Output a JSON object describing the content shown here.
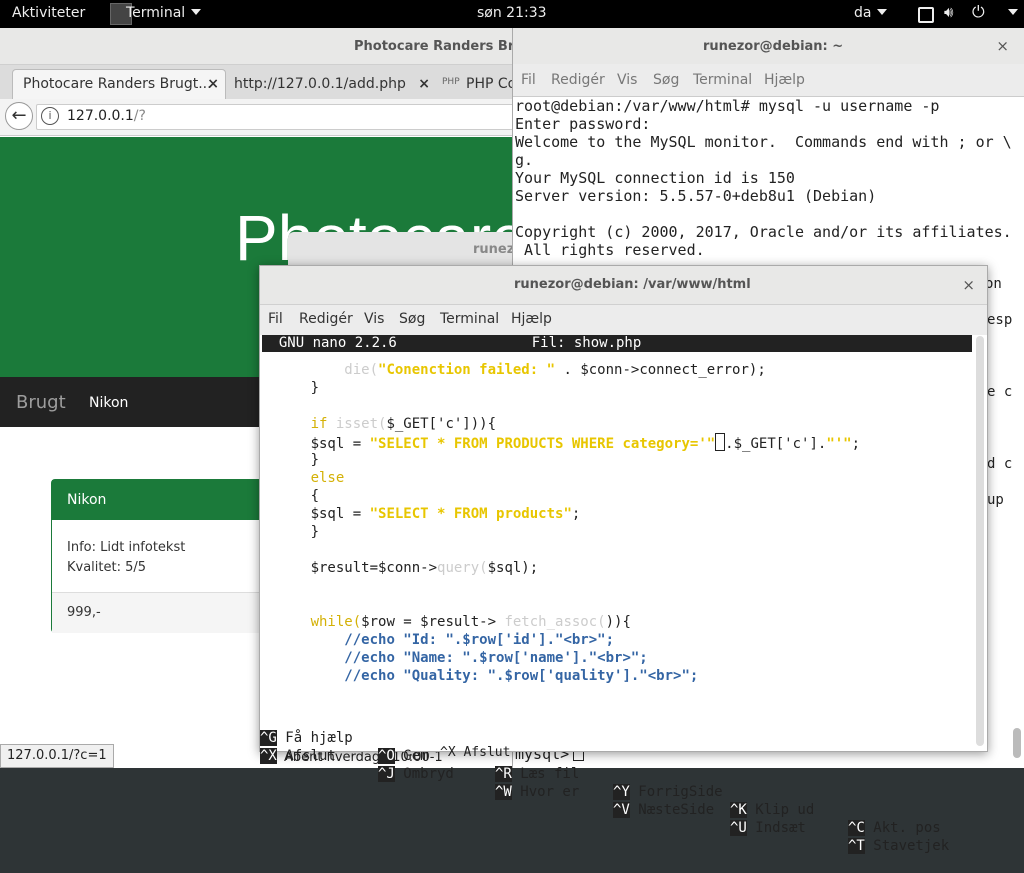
{
  "topbar": {
    "activities": "Aktiviteter",
    "app_menu": "Terminal",
    "clock": "søn 21:33",
    "language": "da"
  },
  "browser": {
    "window_title": "Photocare Randers Brugt",
    "tabs": [
      {
        "label": "Photocare Randers Brugt...",
        "close": "×"
      },
      {
        "label": "http://127.0.0.1/add.php",
        "close": "×"
      },
      {
        "label": "PHP Co"
      }
    ],
    "url": {
      "host": "127.0.0.1",
      "path": "/?"
    },
    "hero_title": "Photocare",
    "nav": {
      "brand": "Brugt",
      "link": "Nikon"
    },
    "card": {
      "heading": "Nikon",
      "info": "Info: Lidt infotekst",
      "quality": "Kvalitet: 5/5",
      "price": "999,-"
    },
    "status_url": "127.0.0.1/?c=1",
    "opening_hours": "Åbent hverdage 10:00-1"
  },
  "bg_window": {
    "title": "runez"
  },
  "term1": {
    "title": "runezor@debian: ~",
    "close": "×",
    "menu": [
      "Fil",
      "Redigér",
      "Vis",
      "Søg",
      "Terminal",
      "Hjælp"
    ],
    "lines": [
      "root@debian:/var/www/html# mysql -u username -p",
      "Enter password:",
      "Welcome to the MySQL monitor.  Commands end with ; or \\",
      "g.",
      "Your MySQL connection id is 150",
      "Server version: 5.5.57-0+deb8u1 (Debian)",
      "",
      "Copyright (c) 2000, 2017, Oracle and/or its affiliates.",
      " All rights reserved."
    ],
    "right_fragments": [
      "on",
      "esp",
      "e c",
      "d c",
      "up"
    ],
    "prompt": "mysql>"
  },
  "term2": {
    "title": "runezor@debian: /var/www/html",
    "close": "×",
    "menu": [
      "Fil",
      "Redigér",
      "Vis",
      "Søg",
      "Terminal",
      "Hjælp"
    ],
    "nano_header": "  GNU nano 2.2.6                Fil: show.php",
    "code": {
      "l1_fn": "die(",
      "l1_str": "\"Conenction failed: \"",
      "l1_rest": " . $conn->connect_error);",
      "l2": "}",
      "l4_kw": "if",
      "l4_fn": "isset(",
      "l4_rest": "$_GET['c'])){",
      "l5_a": "$sql = ",
      "l5_str": "\"SELECT * FROM PRODUCTS WHERE category='\"",
      "l5_b": ".$_GET['c'].",
      "l5_str2": "\"'\"",
      "l5_c": ";",
      "l6": "}",
      "l7_kw": "else",
      "l8": "{",
      "l9_a": "$sql = ",
      "l9_str": "\"SELECT * FROM products\"",
      "l9_c": ";",
      "l10": "}",
      "l12_a": "$result=$conn->",
      "l12_fn": "query(",
      "l12_b": "$sql);",
      "l15_kw": "while(",
      "l15_a": "$row = $result-> ",
      "l15_fn": "fetch_assoc(",
      "l15_b": ")){",
      "c1": "//echo \"Id: \".$row['id'].\"<br>\";",
      "c2": "//echo \"Name: \".$row['name'].\"<br>\";",
      "c3": "//echo \"Quality: \".$row['quality'].\"<br>\";"
    },
    "shortcuts_row1": [
      {
        "key": "^G",
        "label": " Få hjælp"
      },
      {
        "key": "^O",
        "label": " Gem"
      },
      {
        "key": "^R",
        "label": " Læs fil"
      },
      {
        "key": "^Y",
        "label": " ForrigSide"
      },
      {
        "key": "^K",
        "label": " Klip ud"
      },
      {
        "key": "^C",
        "label": " Akt. pos"
      }
    ],
    "shortcuts_row2": [
      {
        "key": "^X",
        "label": " Afslut"
      },
      {
        "key": "^J",
        "label": " Ombryd"
      },
      {
        "key": "^W",
        "label": " Hvor er"
      },
      {
        "key": "^V",
        "label": " NæsteSide"
      },
      {
        "key": "^U",
        "label": " Indsæt"
      },
      {
        "key": "^T",
        "label": " Stavetjek"
      }
    ],
    "behind_text": "^X Afslut"
  }
}
